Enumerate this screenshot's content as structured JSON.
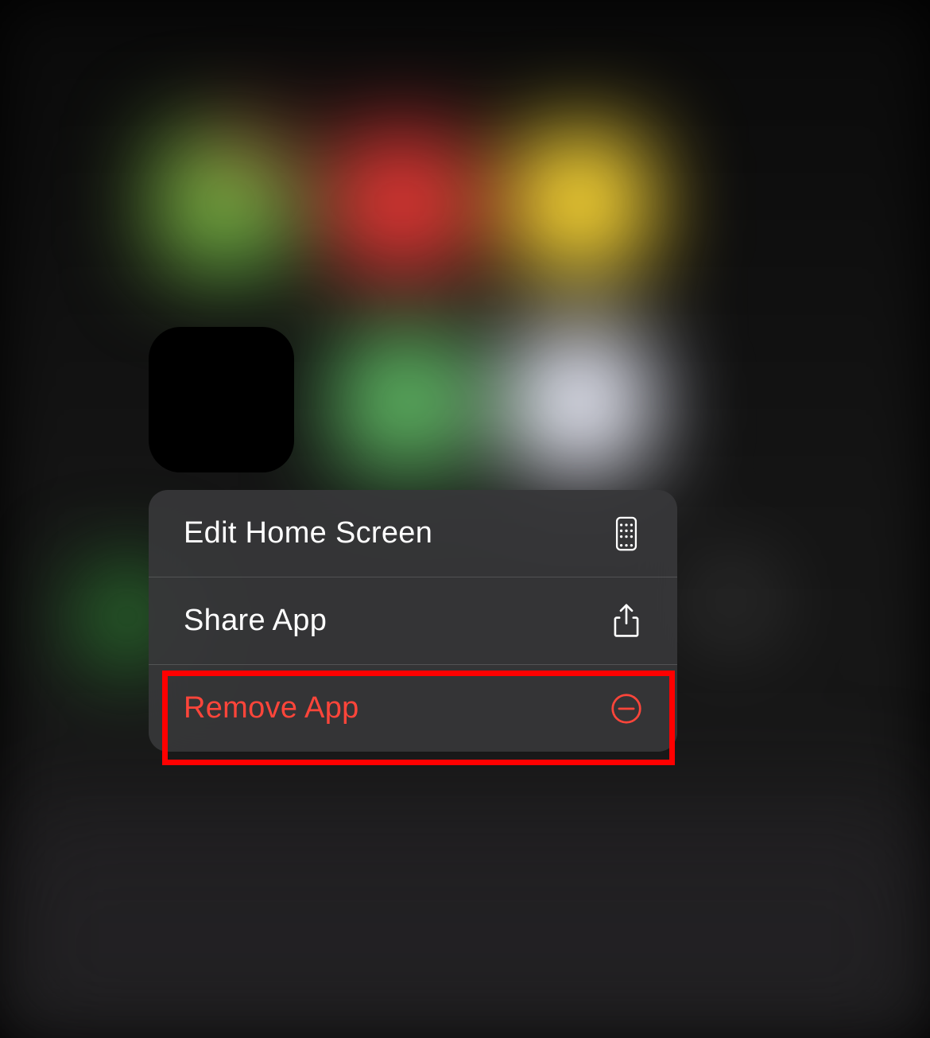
{
  "contextMenu": {
    "items": [
      {
        "label": "Edit Home Screen",
        "icon": "phone-grid-icon",
        "destructive": false
      },
      {
        "label": "Share App",
        "icon": "share-icon",
        "destructive": false
      },
      {
        "label": "Remove App",
        "icon": "minus-circle-icon",
        "destructive": true
      }
    ]
  },
  "highlightedItem": 2
}
